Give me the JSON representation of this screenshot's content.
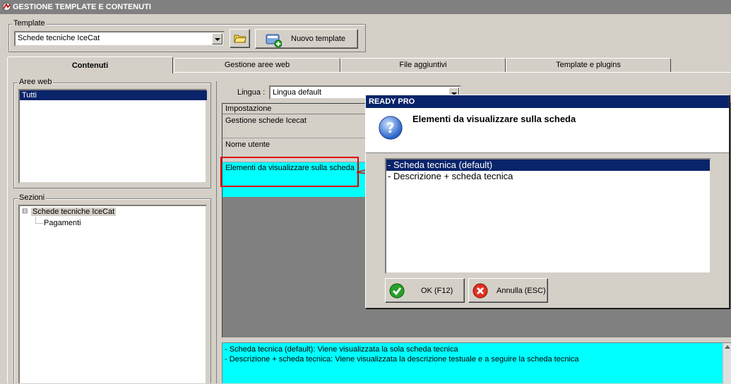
{
  "window": {
    "title": "GESTIONE TEMPLATE E CONTENUTI"
  },
  "template_group": {
    "label": "Template",
    "selected": "Schede tecniche IceCat",
    "new_button": "Nuovo template"
  },
  "tabs": [
    {
      "label": "Contenuti",
      "active": true
    },
    {
      "label": "Gestione aree web",
      "active": false
    },
    {
      "label": "File aggiuntivi",
      "active": false
    },
    {
      "label": "Template e plugins",
      "active": false
    }
  ],
  "aree_web": {
    "label": "Aree web",
    "items": [
      "Tutti"
    ]
  },
  "sezioni": {
    "label": "Sezioni",
    "tree": [
      {
        "label": "Schede tecniche IceCat",
        "expander": "⊟",
        "children": [
          "Pagamenti"
        ]
      }
    ]
  },
  "lingua": {
    "label": "Lingua :",
    "selected": "Lingua default"
  },
  "settings_grid": {
    "header": "Impostazione",
    "rows": [
      "Gestione schede Icecat",
      "Nome utente",
      "Elementi da visualizzare sulla scheda"
    ]
  },
  "description": {
    "lines": [
      "- Scheda tecnica (default): Viene visualizzata la sola scheda tecnica",
      "- Descrizione + scheda tecnica: Viene visualizzata la descrizione testuale e a seguire la scheda tecnica"
    ]
  },
  "dialog": {
    "title": "READY PRO",
    "question": "Elementi da visualizzare sulla scheda",
    "options": [
      "- Scheda tecnica (default)",
      "- Descrizione + scheda tecnica"
    ],
    "selected_index": 0,
    "ok_button": "OK (F12)",
    "cancel_button": "Annulla (ESC)"
  },
  "colors": {
    "selection": "#0a246a",
    "highlight_cyan": "#00ffff",
    "callout_red": "#e00000"
  }
}
